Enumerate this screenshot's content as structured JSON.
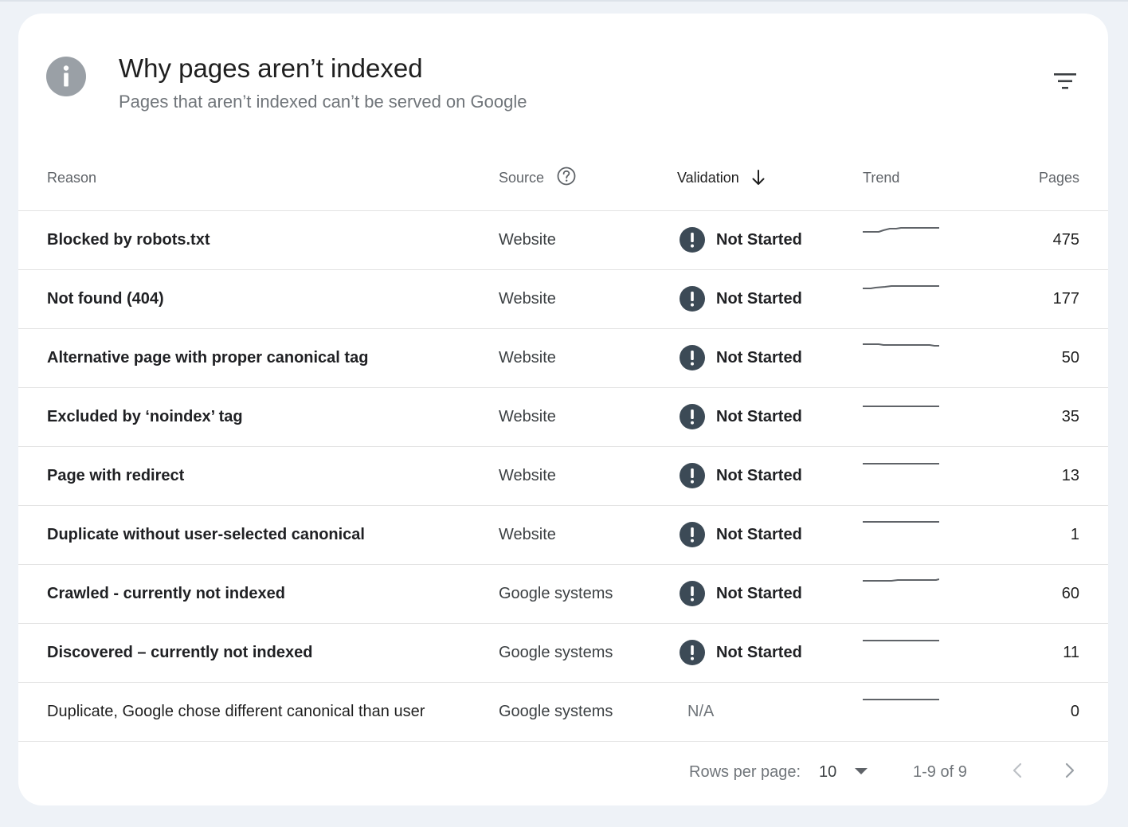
{
  "header": {
    "title": "Why pages aren’t indexed",
    "subtitle": "Pages that aren’t indexed can’t be served on Google",
    "icon": "info-icon",
    "filter_icon": "filter-icon"
  },
  "table": {
    "columns": {
      "reason": "Reason",
      "source": "Source",
      "validation": "Validation",
      "trend": "Trend",
      "pages": "Pages"
    },
    "sort_column": "Validation",
    "sort_direction": "descending",
    "rows": [
      {
        "reason": "Blocked by robots.txt",
        "source": "Website",
        "validation": "Not Started",
        "pages": "475",
        "strong": true
      },
      {
        "reason": "Not found (404)",
        "source": "Website",
        "validation": "Not Started",
        "pages": "177",
        "strong": true
      },
      {
        "reason": "Alternative page with proper canonical tag",
        "source": "Website",
        "validation": "Not Started",
        "pages": "50",
        "strong": true
      },
      {
        "reason": "Excluded by ‘noindex’ tag",
        "source": "Website",
        "validation": "Not Started",
        "pages": "35",
        "strong": true
      },
      {
        "reason": "Page with redirect",
        "source": "Website",
        "validation": "Not Started",
        "pages": "13",
        "strong": true
      },
      {
        "reason": "Duplicate without user-selected canonical",
        "source": "Website",
        "validation": "Not Started",
        "pages": "1",
        "strong": true
      },
      {
        "reason": "Crawled - currently not indexed",
        "source": "Google systems",
        "validation": "Not Started",
        "pages": "60",
        "strong": true
      },
      {
        "reason": "Discovered – currently not indexed",
        "source": "Google systems",
        "validation": "Not Started",
        "pages": "11",
        "strong": true
      },
      {
        "reason": "Duplicate, Google chose different canonical than user",
        "source": "Google systems",
        "validation": "N/A",
        "pages": "0",
        "strong": false
      }
    ]
  },
  "footer": {
    "rows_per_page_label": "Rows per page:",
    "rows_per_page_value": "10",
    "range": "1-9 of 9"
  },
  "colors": {
    "status_icon": "#3c4a56",
    "trend_line": "#5f6368",
    "background": "#eef2f7"
  }
}
